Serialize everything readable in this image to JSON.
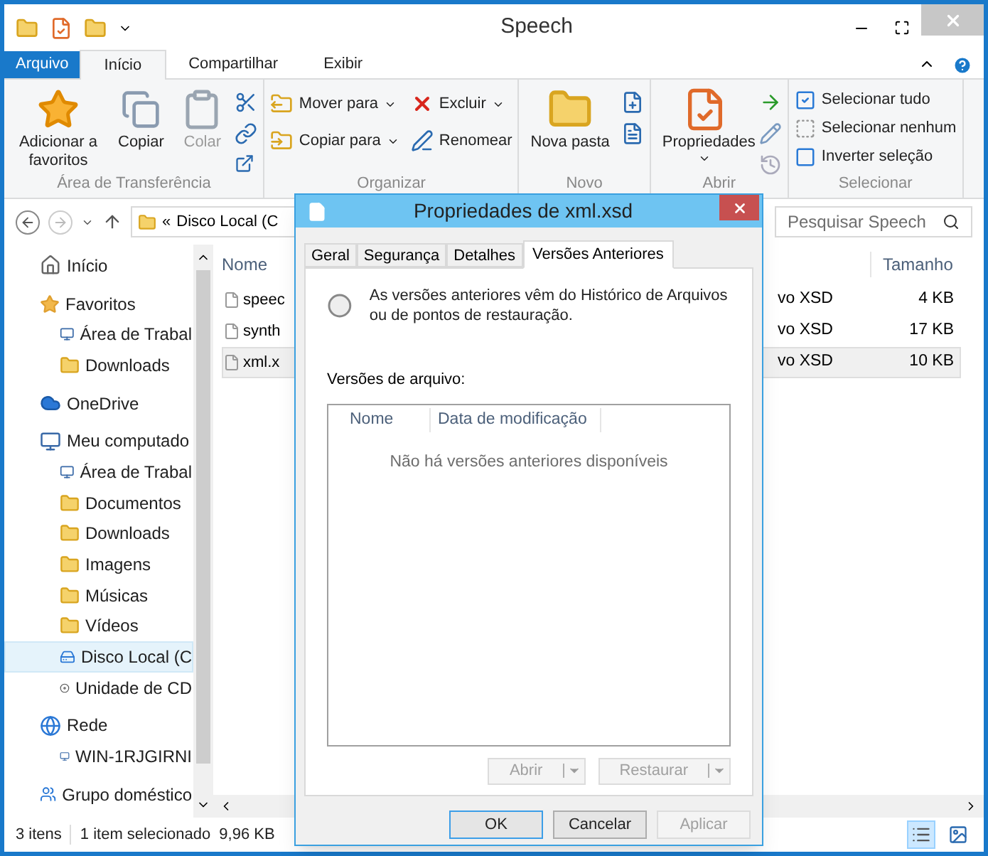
{
  "window": {
    "title": "Speech"
  },
  "ribbon_tabs": [
    {
      "label": "Arquivo",
      "kind": "menu",
      "selected": false
    },
    {
      "label": "Início",
      "kind": "tab",
      "selected": true
    },
    {
      "label": "Compartilhar",
      "kind": "tab",
      "selected": false
    },
    {
      "label": "Exibir",
      "kind": "tab",
      "selected": false
    }
  ],
  "ribbon_groups": [
    {
      "label": "Área de Transferência",
      "items": [
        {
          "kind": "large",
          "label": "Adicionar a favoritos",
          "disabled": false,
          "dropdown": false
        },
        {
          "kind": "large",
          "label": "Copiar",
          "disabled": false,
          "dropdown": false
        },
        {
          "kind": "large",
          "label": "Colar",
          "disabled": true,
          "dropdown": false
        }
      ]
    },
    {
      "label": "Organizar",
      "items": [
        {
          "kind": "small",
          "label": "Mover para",
          "disabled": false,
          "dropdown": true
        },
        {
          "kind": "small",
          "label": "Copiar para",
          "disabled": false,
          "dropdown": true
        },
        {
          "kind": "small",
          "label": "Excluir",
          "disabled": false,
          "dropdown": true
        },
        {
          "kind": "small",
          "label": "Renomear",
          "disabled": false,
          "dropdown": false
        }
      ]
    },
    {
      "label": "Novo",
      "items": [
        {
          "kind": "large",
          "label": "Nova pasta",
          "disabled": false,
          "dropdown": false
        }
      ]
    },
    {
      "label": "Abrir",
      "items": [
        {
          "kind": "large",
          "label": "Propriedades",
          "disabled": false,
          "dropdown": true
        }
      ]
    },
    {
      "label": "Selecionar",
      "items": [
        {
          "kind": "small",
          "label": "Selecionar tudo",
          "disabled": false,
          "dropdown": false
        },
        {
          "kind": "small",
          "label": "Selecionar nenhum",
          "disabled": false,
          "dropdown": false
        },
        {
          "kind": "small",
          "label": "Inverter seleção",
          "disabled": false,
          "dropdown": false
        }
      ]
    }
  ],
  "address": {
    "prefix": "«",
    "path": "Disco Local (C"
  },
  "search": {
    "placeholder": "Pesquisar Speech"
  },
  "nav": [
    {
      "label": "Início",
      "selected": false
    },
    {
      "label": "Favoritos",
      "selected": false,
      "children": [
        {
          "label": "Área de Trabal",
          "selected": false
        },
        {
          "label": "Downloads",
          "selected": false
        }
      ]
    },
    {
      "label": "OneDrive",
      "selected": false
    },
    {
      "label": "Meu computado",
      "selected": false,
      "children": [
        {
          "label": "Área de Trabal",
          "selected": false
        },
        {
          "label": "Documentos",
          "selected": false
        },
        {
          "label": "Downloads",
          "selected": false
        },
        {
          "label": "Imagens",
          "selected": false
        },
        {
          "label": "Músicas",
          "selected": false
        },
        {
          "label": "Vídeos",
          "selected": false
        },
        {
          "label": "Disco Local (C",
          "selected": true
        },
        {
          "label": "Unidade de CD",
          "selected": false
        }
      ]
    },
    {
      "label": "Rede",
      "selected": false,
      "children": [
        {
          "label": "WIN-1RJGIRNI",
          "selected": false
        }
      ]
    },
    {
      "label": "Grupo doméstico",
      "selected": false
    }
  ],
  "files": {
    "columns": [
      "Nome",
      "Tamanho"
    ],
    "rows": [
      {
        "name": "speec",
        "type": "vo XSD",
        "size": "4 KB",
        "selected": false
      },
      {
        "name": "synth",
        "type": "vo XSD",
        "size": "17 KB",
        "selected": false
      },
      {
        "name": "xml.x",
        "type": "vo XSD",
        "size": "10 KB",
        "selected": true
      }
    ]
  },
  "status_bar": {
    "count": "3 itens",
    "selection": "1 item selecionado",
    "size": "9,96 KB",
    "views": [
      {
        "kind": "details",
        "selected": true
      },
      {
        "kind": "tiles",
        "selected": false
      }
    ]
  },
  "dialog": {
    "title": "Propriedades de xml.xsd",
    "tabs": [
      {
        "label": "Geral",
        "selected": false
      },
      {
        "label": "Segurança",
        "selected": false
      },
      {
        "label": "Detalhes",
        "selected": false
      },
      {
        "label": "Versões Anteriores",
        "selected": true
      }
    ],
    "info": "As versões anteriores vêm do Histórico de Arquivos ou de pontos de restauração.",
    "list_label": "Versões de arquivo:",
    "list_columns": [
      "Nome",
      "Data de modificação"
    ],
    "empty_message": "Não há versões anteriores disponíveis",
    "list_buttons": [
      {
        "label": "Abrir",
        "disabled": true
      },
      {
        "label": "Restaurar",
        "disabled": true
      }
    ],
    "buttons": [
      {
        "label": "OK",
        "kind": "default",
        "disabled": false
      },
      {
        "label": "Cancelar",
        "kind": "normal",
        "disabled": false
      },
      {
        "label": "Aplicar",
        "kind": "normal",
        "disabled": true
      }
    ]
  }
}
